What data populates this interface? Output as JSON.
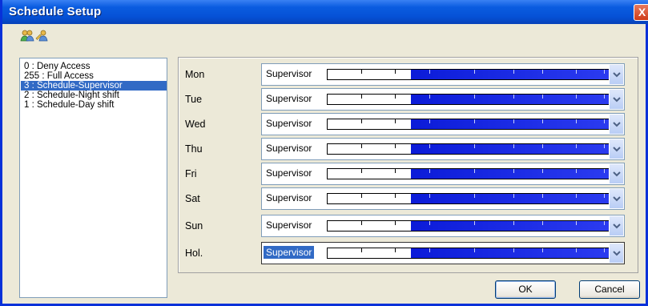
{
  "window": {
    "title": "Schedule Setup",
    "close_glyph": "X"
  },
  "toolbar": {
    "icons": [
      "add-users-icon",
      "edit-user-icon"
    ]
  },
  "schedules": [
    {
      "label": "0 : Deny Access",
      "selected": false
    },
    {
      "label": "255 : Full Access",
      "selected": false
    },
    {
      "label": "3 : Schedule-Supervisor",
      "selected": true
    },
    {
      "label": "2 : Schedule-Night shift",
      "selected": false
    },
    {
      "label": "1 : Schedule-Day shift",
      "selected": false
    }
  ],
  "days": [
    {
      "label": "Mon",
      "value": "Supervisor",
      "active_start": 0.295,
      "selected": false
    },
    {
      "label": "Tue",
      "value": "Supervisor",
      "active_start": 0.295,
      "selected": false
    },
    {
      "label": "Wed",
      "value": "Supervisor",
      "active_start": 0.295,
      "selected": false
    },
    {
      "label": "Thu",
      "value": "Supervisor",
      "active_start": 0.295,
      "selected": false
    },
    {
      "label": "Fri",
      "value": "Supervisor",
      "active_start": 0.295,
      "selected": false
    },
    {
      "label": "Sat",
      "value": "Supervisor",
      "active_start": 0.295,
      "selected": false
    },
    {
      "label": "Sun",
      "value": "Supervisor",
      "active_start": 0.295,
      "selected": false
    },
    {
      "label": "Hol.",
      "value": "Supervisor",
      "active_start": 0.295,
      "selected": true
    }
  ],
  "buttons": {
    "ok": "OK",
    "cancel": "Cancel"
  },
  "colors": {
    "title_bar": "#0551d6",
    "selection": "#316ac5",
    "active_time": "#1a2be6"
  }
}
